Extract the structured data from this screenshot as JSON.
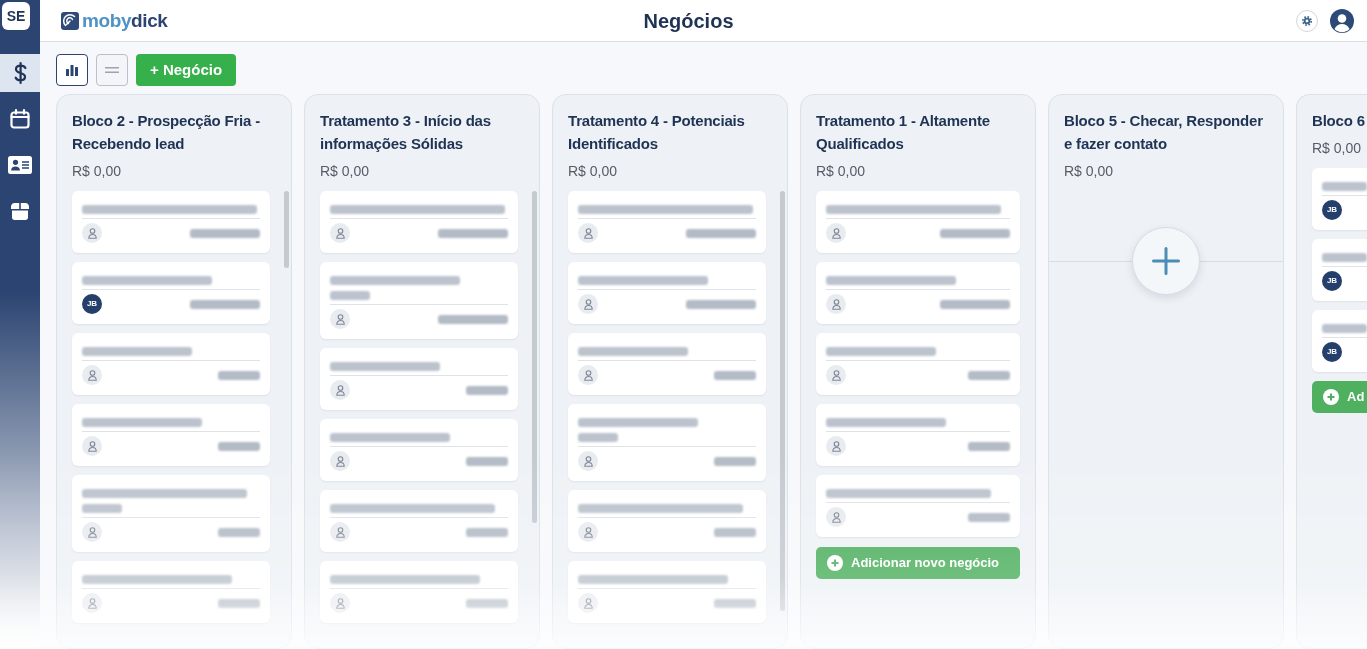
{
  "sidebar": {
    "badge": "SE",
    "items": [
      {
        "kind": "dollar",
        "selected": true
      },
      {
        "kind": "calendar",
        "selected": false
      },
      {
        "kind": "contact-card",
        "selected": false
      },
      {
        "kind": "box",
        "selected": false
      }
    ]
  },
  "header": {
    "logo": {
      "part_1": "moby",
      "part_2": "dick"
    },
    "title": "Negócios"
  },
  "toolbar": {
    "view_buttons": [
      {
        "kind": "chart",
        "selected": true
      },
      {
        "kind": "list",
        "selected": false
      }
    ],
    "add_button": "+ Negócio"
  },
  "columns": [
    {
      "title": "Bloco 2 - Prospecção Fria - Recebendo lead",
      "total": "R$ 0,00",
      "scrollbar": true,
      "cards": [
        {
          "owner": {
            "kind": "person"
          },
          "long_title": false
        },
        {
          "owner": {
            "kind": "initials",
            "initials": "JB"
          },
          "long_title": false
        },
        {
          "owner": {
            "kind": "person"
          },
          "long_title": false
        },
        {
          "owner": {
            "kind": "person"
          },
          "long_title": false
        },
        {
          "owner": {
            "kind": "person"
          },
          "long_title": true
        },
        {
          "owner": {
            "kind": "person"
          },
          "long_title": false
        }
      ]
    },
    {
      "title": "Tratamento 3 - Início das informações Sólidas",
      "total": "R$ 0,00",
      "scrollbar": true,
      "cards": [
        {
          "owner": {
            "kind": "person"
          },
          "long_title": false
        },
        {
          "owner": {
            "kind": "person"
          },
          "long_title": true
        },
        {
          "owner": {
            "kind": "person"
          },
          "long_title": false
        },
        {
          "owner": {
            "kind": "person"
          },
          "long_title": false
        },
        {
          "owner": {
            "kind": "person"
          },
          "long_title": false
        },
        {
          "owner": {
            "kind": "person"
          },
          "long_title": false
        }
      ]
    },
    {
      "title": "Tratamento 4 - Potenciais Identificados",
      "total": "R$ 0,00",
      "scrollbar": true,
      "cards": [
        {
          "owner": {
            "kind": "person"
          },
          "long_title": false
        },
        {
          "owner": {
            "kind": "person"
          },
          "long_title": false
        },
        {
          "owner": {
            "kind": "person"
          },
          "long_title": false
        },
        {
          "owner": {
            "kind": "person"
          },
          "long_title": true
        },
        {
          "owner": {
            "kind": "person"
          },
          "long_title": false
        },
        {
          "owner": {
            "kind": "person"
          },
          "long_title": false
        }
      ]
    },
    {
      "title": "Tratamento 1 - Altamente Qualificados",
      "total": "R$ 0,00",
      "scrollbar": false,
      "cards": [
        {
          "owner": {
            "kind": "person"
          },
          "long_title": false
        },
        {
          "owner": {
            "kind": "person"
          },
          "long_title": false
        },
        {
          "owner": {
            "kind": "person"
          },
          "long_title": false
        },
        {
          "owner": {
            "kind": "person"
          },
          "long_title": false
        },
        {
          "owner": {
            "kind": "person"
          },
          "long_title": false
        }
      ],
      "add_button": "Adicionar novo negócio"
    },
    {
      "title": "Bloco 5 - Checar, Responder e fazer contato",
      "total": "R$ 0,00",
      "scrollbar": false
    },
    {
      "title": "Bloco 6",
      "total": "R$ 0,00",
      "scrollbar": false,
      "cards": [
        {
          "owner": {
            "kind": "initials",
            "initials": "JB"
          },
          "long_title": false
        },
        {
          "owner": {
            "kind": "initials",
            "initials": "JB"
          },
          "long_title": false
        },
        {
          "owner": {
            "kind": "initials",
            "initials": "JB"
          },
          "long_title": false
        }
      ],
      "add_button": "Ad"
    }
  ]
}
